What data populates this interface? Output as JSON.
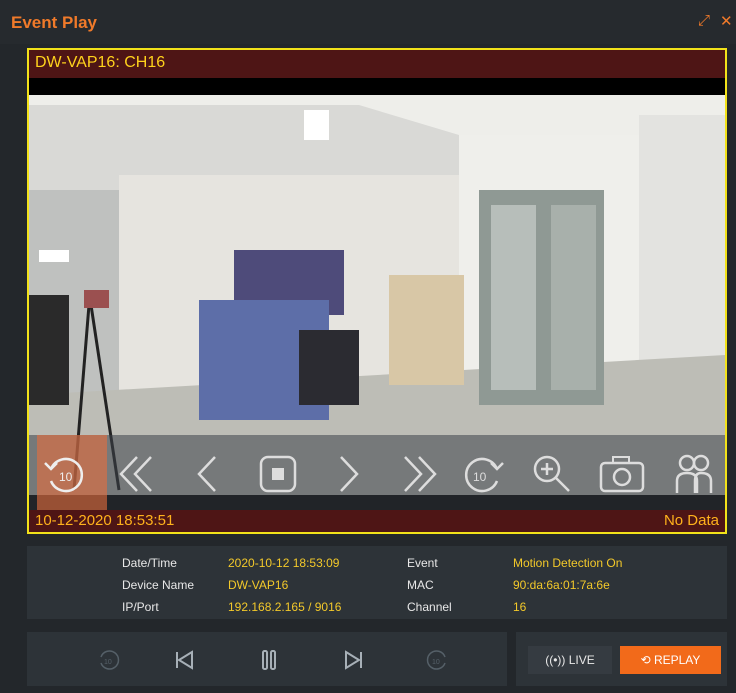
{
  "window": {
    "title": "Event Play",
    "expand_icon": "expand-icon",
    "close_icon": "close-icon"
  },
  "viewer": {
    "channel_label": "DW-VAP16: CH16",
    "timestamp": "10-12-2020 18:53:51",
    "no_data": "No Data",
    "controls": [
      "rewind-10s-icon",
      "fast-rewind-icon",
      "step-back-icon",
      "stop-icon",
      "step-forward-icon",
      "fast-forward-icon",
      "forward-10s-icon",
      "zoom-in-icon",
      "snapshot-icon",
      "user-icon"
    ]
  },
  "info": {
    "date_time_label": "Date/Time",
    "date_time": "2020-10-12 18:53:09",
    "device_name_label": "Device Name",
    "device_name": "DW-VAP16",
    "ip_port_label": "IP/Port",
    "ip_port": "192.168.2.165 / 9016",
    "event_label": "Event",
    "event": "Motion Detection On",
    "mac_label": "MAC",
    "mac": "90:da:6a:01:7a:6e",
    "channel_label": "Channel",
    "channel": "16"
  },
  "playback": {
    "buttons": [
      "rewind-10s-icon",
      "skip-back-icon",
      "pause-icon",
      "skip-forward-icon",
      "forward-10s-icon"
    ]
  },
  "mode": {
    "live_label": "LIVE",
    "replay_label": "REPLAY"
  }
}
